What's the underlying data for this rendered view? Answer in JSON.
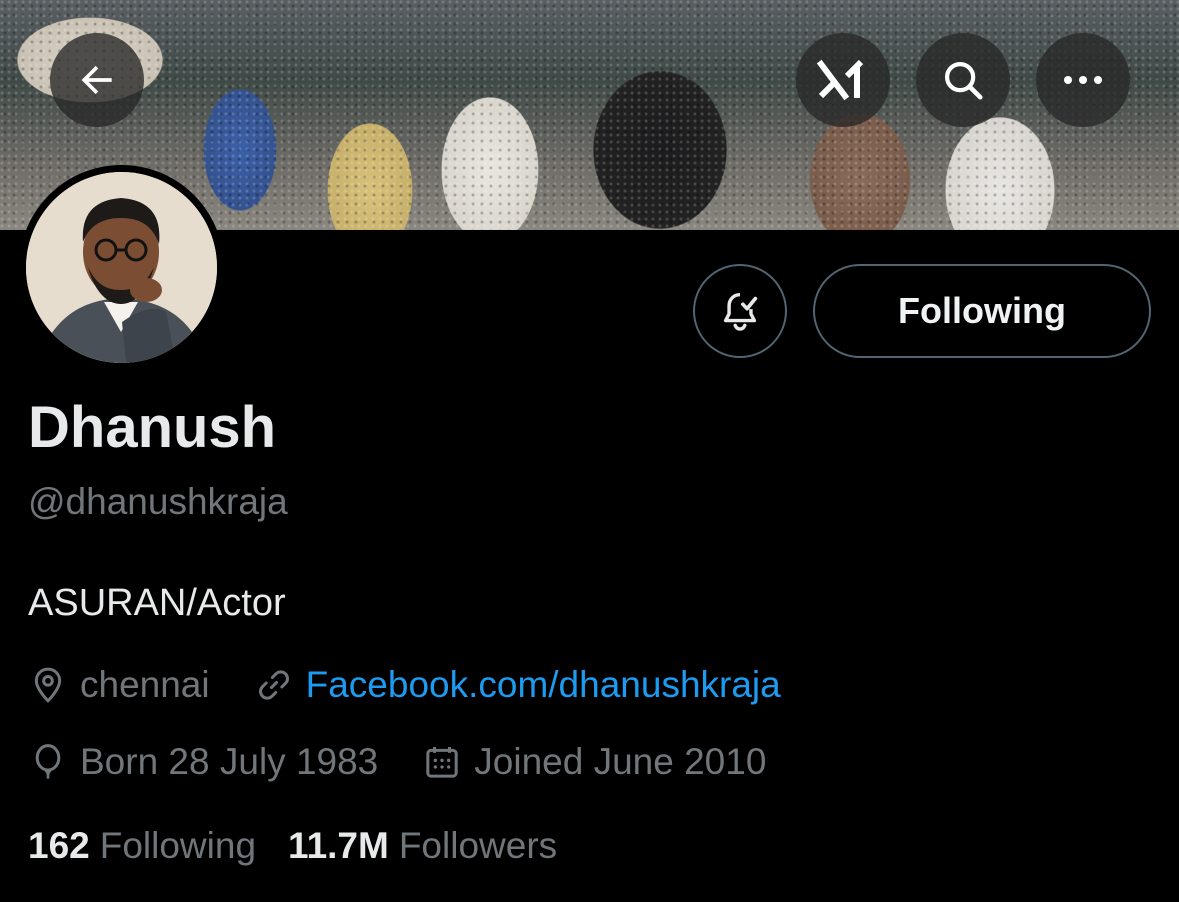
{
  "banner": {
    "description_icon": "banner-photo"
  },
  "nav": {
    "back_icon": "arrow-left-icon",
    "grok_icon": "grok-icon",
    "search_icon": "search-icon",
    "more_icon": "more-icon"
  },
  "profile": {
    "display_name": "Dhanush",
    "handle": "@dhanushkraja",
    "bio": "ASURAN/Actor",
    "location": "chennai",
    "website": "Facebook.com/dhanushkraja",
    "birthday": "Born 28 July 1983",
    "joined": "Joined June 2010"
  },
  "actions": {
    "following_label": "Following",
    "notification_icon": "bell-check-icon"
  },
  "stats": {
    "following_count": "162",
    "following_label": "Following",
    "followers_count": "11.7M",
    "followers_label": "Followers"
  },
  "colors": {
    "background": "#000000",
    "primary_text": "#e7e9ea",
    "secondary_text": "#71767b",
    "link": "#1d9bf0",
    "border": "#536471"
  }
}
